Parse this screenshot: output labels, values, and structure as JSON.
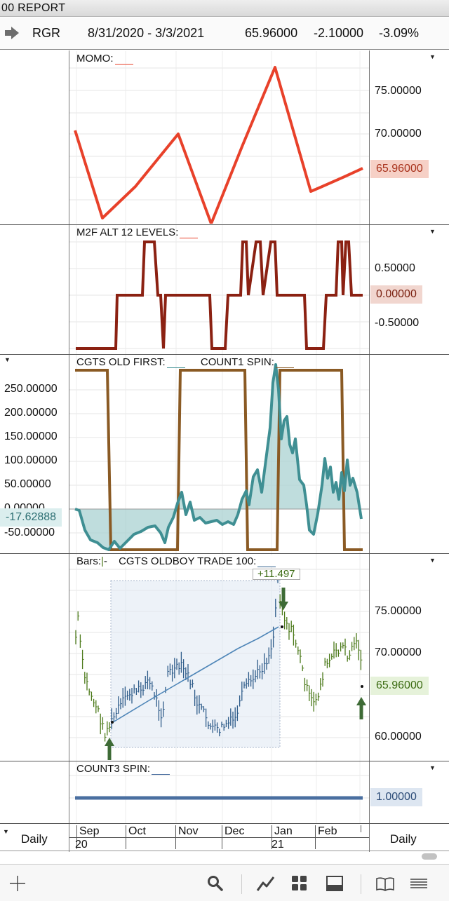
{
  "window": {
    "title": "00  REPORT"
  },
  "symbol_bar": {
    "symbol": "RGR",
    "date_range": "8/31/2020 - 3/3/2021",
    "last": "65.96000",
    "change": "-2.10000",
    "change_pct": "-3.09%"
  },
  "panes": {
    "momo": {
      "title": "MOMO:",
      "ticks": [
        "75.00000",
        "70.00000"
      ],
      "current_value": "65.96000",
      "line_color": "#e8412a",
      "box_color": "#f6d0c6"
    },
    "m2f": {
      "title": "M2F ALT 12 LEVELS:",
      "ticks": [
        "0.50000",
        "-0.50000"
      ],
      "current_value": "0.00000",
      "line_color": "#8b2112",
      "box_color": "#f1d6cf"
    },
    "cgts": {
      "title1": "CGTS OLD FIRST:",
      "title2": "COUNT1 SPIN:",
      "ticks": [
        "250.00000",
        "200.00000",
        "150.00000",
        "100.00000",
        "50.00000",
        "0.00000",
        "-50.00000"
      ],
      "current_value": "-17.62888",
      "teal_color": "#3f8f93",
      "brown_color": "#8a5a24"
    },
    "price": {
      "bars_label": "Bars:",
      "title": "CGTS OLDBOY TRADE 100:",
      "trade_label": "+11.497",
      "ticks": [
        "75.00000",
        "70.00000",
        "60.00000"
      ],
      "current_value": "65.96000",
      "up_color": "#4c7a1a",
      "trade_color": "#2e5c8a",
      "box_color": "#e6f2da"
    },
    "count3": {
      "title": "COUNT3 SPIN:",
      "current_value": "1.00000",
      "line_color": "#4a6fa0",
      "box_color": "#dde6f1"
    }
  },
  "time_axis": {
    "period_left": "Daily",
    "period_right": "Daily",
    "months": [
      "Sep",
      "Oct",
      "Nov",
      "Dec",
      "Jan",
      "Feb"
    ],
    "years": [
      "20",
      "21"
    ]
  },
  "toolbar": {
    "icons": [
      "plus-icon",
      "search-icon",
      "line-chart-icon",
      "grid-icon",
      "window-icon",
      "book-icon",
      "menu-icon"
    ]
  }
}
